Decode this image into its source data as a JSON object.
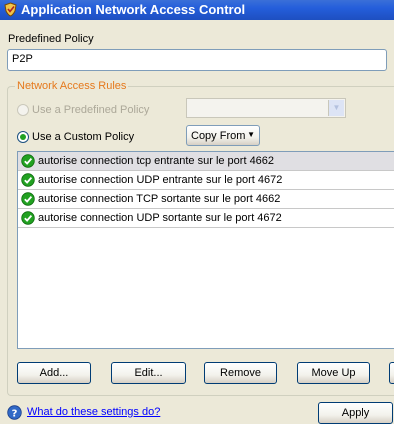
{
  "window": {
    "title": "Application Network Access Control"
  },
  "policy": {
    "label": "Predefined Policy",
    "value": "P2P"
  },
  "rules_group": {
    "title": "Network Access Rules",
    "predefined_label": "Use a Predefined Policy",
    "custom_label": "Use a Custom Policy",
    "copy_from_label": "Copy From",
    "selected": "custom"
  },
  "rules": [
    {
      "label": "autorise connection tcp entrante sur le port 4662",
      "selected": true
    },
    {
      "label": "autorise connection UDP entrante sur le port 4672",
      "selected": false
    },
    {
      "label": "autorise connection TCP sortante sur le port 4662",
      "selected": false
    },
    {
      "label": "autorise connection UDP sortante sur le port 4672",
      "selected": false
    }
  ],
  "buttons": {
    "add": "Add...",
    "edit": "Edit...",
    "remove": "Remove",
    "move_up": "Move Up",
    "apply": "Apply"
  },
  "help": {
    "link": "What do these settings do?"
  },
  "colors": {
    "titlebar": "#245EDB",
    "group_title": "#E5791D",
    "check": "#21A121",
    "link": "#0000FF"
  }
}
